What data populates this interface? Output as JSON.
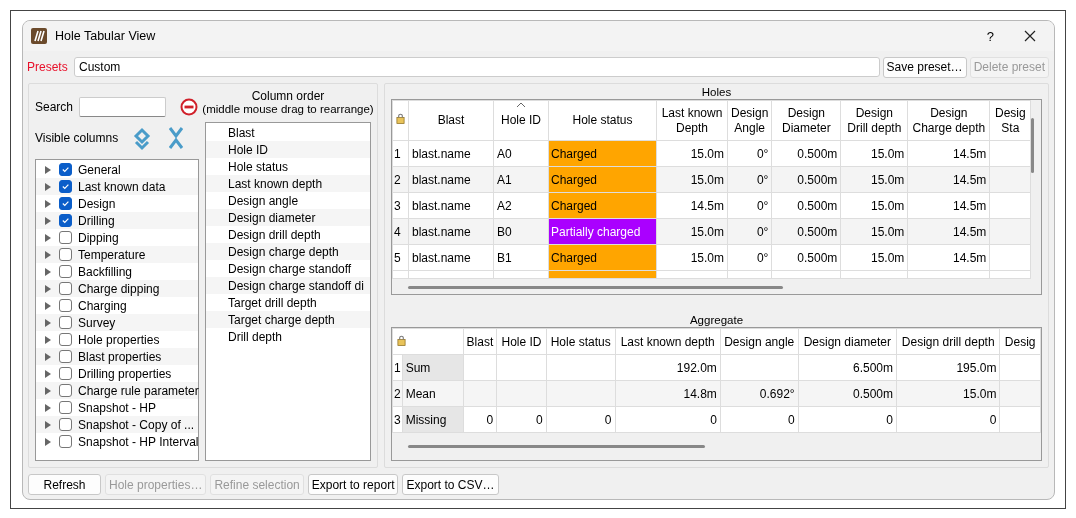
{
  "window": {
    "title": "Hole Tabular View",
    "help": "?"
  },
  "presets": {
    "label": "Presets",
    "value": "Custom",
    "buttons": [
      {
        "label": "Save preset…",
        "disabled": false
      },
      {
        "label": "Delete preset",
        "disabled": true
      }
    ]
  },
  "search": {
    "label": "Search"
  },
  "visible_columns": {
    "label": "Visible columns",
    "items": [
      {
        "label": "General",
        "checked": true
      },
      {
        "label": "Last known data",
        "checked": true
      },
      {
        "label": "Design",
        "checked": true
      },
      {
        "label": "Drilling",
        "checked": true
      },
      {
        "label": "Dipping",
        "checked": false
      },
      {
        "label": "Temperature",
        "checked": false
      },
      {
        "label": "Backfilling",
        "checked": false
      },
      {
        "label": "Charge dipping",
        "checked": false
      },
      {
        "label": "Charging",
        "checked": false
      },
      {
        "label": "Survey",
        "checked": false
      },
      {
        "label": "Hole properties",
        "checked": false
      },
      {
        "label": "Blast properties",
        "checked": false
      },
      {
        "label": "Drilling properties",
        "checked": false
      },
      {
        "label": "Charge rule parameter",
        "checked": false
      },
      {
        "label": "Snapshot - HP",
        "checked": false
      },
      {
        "label": "Snapshot - Copy of ...",
        "checked": false
      },
      {
        "label": "Snapshot - HP Interval",
        "checked": false
      }
    ]
  },
  "column_order": {
    "title": "Column order",
    "hint": "(middle mouse drag to rearrange)",
    "items": [
      "Blast",
      "Hole ID",
      "Hole status",
      "Last known depth",
      "Design angle",
      "Design diameter",
      "Design drill depth",
      "Design charge depth",
      "Design charge standoff",
      "Design charge standoff di",
      "Target drill depth",
      "Target charge depth",
      "Drill depth"
    ]
  },
  "holes": {
    "title": "Holes",
    "columns": [
      {
        "label": "Blast",
        "sorted": false
      },
      {
        "label": "Hole ID",
        "sorted": true
      },
      {
        "label": "Hole status",
        "sorted": false
      },
      {
        "label": "Last known\nDepth",
        "sorted": false
      },
      {
        "label": "Design\nAngle",
        "sorted": false
      },
      {
        "label": "Design\nDiameter",
        "sorted": false
      },
      {
        "label": "Design\nDrill depth",
        "sorted": false
      },
      {
        "label": "Design\nCharge depth",
        "sorted": false
      },
      {
        "label": "Desig\nSta",
        "sorted": false
      }
    ],
    "rows": [
      {
        "number": "1",
        "blast": "blast.name",
        "hole_id": "A0",
        "status": {
          "label": "Charged",
          "color": "#ffa500"
        },
        "values": [
          "15.0m",
          "0°",
          "0.500m",
          "15.0m",
          "14.5m"
        ]
      },
      {
        "number": "2",
        "blast": "blast.name",
        "hole_id": "A1",
        "status": {
          "label": "Charged",
          "color": "#ffa500"
        },
        "values": [
          "15.0m",
          "0°",
          "0.500m",
          "15.0m",
          "14.5m"
        ]
      },
      {
        "number": "3",
        "blast": "blast.name",
        "hole_id": "A2",
        "status": {
          "label": "Charged",
          "color": "#ffa500"
        },
        "values": [
          "14.5m",
          "0°",
          "0.500m",
          "15.0m",
          "14.5m"
        ]
      },
      {
        "number": "4",
        "blast": "blast.name",
        "hole_id": "B0",
        "status": {
          "label": "Partially charged",
          "color": "#aa00ff"
        },
        "values": [
          "15.0m",
          "0°",
          "0.500m",
          "15.0m",
          "14.5m"
        ]
      },
      {
        "number": "5",
        "blast": "blast.name",
        "hole_id": "B1",
        "status": {
          "label": "Charged",
          "color": "#ffa500"
        },
        "values": [
          "15.0m",
          "0°",
          "0.500m",
          "15.0m",
          "14.5m"
        ]
      }
    ]
  },
  "aggregate": {
    "title": "Aggregate",
    "columns": [
      "Blast",
      "Hole ID",
      "Hole status",
      "Last known depth",
      "Design angle",
      "Design diameter",
      "Design drill depth",
      "Desig"
    ],
    "rows": [
      {
        "number": "1",
        "label": "Sum",
        "cells": {
          "last_known_depth": "192.0m",
          "design_diameter": "6.500m",
          "design_drill_depth": "195.0m"
        }
      },
      {
        "number": "2",
        "label": "Mean",
        "cells": {
          "last_known_depth": "14.8m",
          "design_angle": "0.692°",
          "design_diameter": "0.500m",
          "design_drill_depth": "15.0m"
        }
      },
      {
        "number": "3",
        "label": "Missing",
        "cells": {
          "blast": "0",
          "hole_id": "0",
          "hole_status": "0",
          "last_known_depth": "0",
          "design_angle": "0",
          "design_diameter": "0",
          "design_drill_depth": "0"
        }
      }
    ]
  },
  "buttons": [
    {
      "label": "Refresh",
      "disabled": false
    },
    {
      "label": "Hole properties…",
      "disabled": true
    },
    {
      "label": "Refine selection",
      "disabled": true
    },
    {
      "label": "Export to report",
      "disabled": false
    },
    {
      "label": "Export to CSV…",
      "disabled": false
    }
  ]
}
